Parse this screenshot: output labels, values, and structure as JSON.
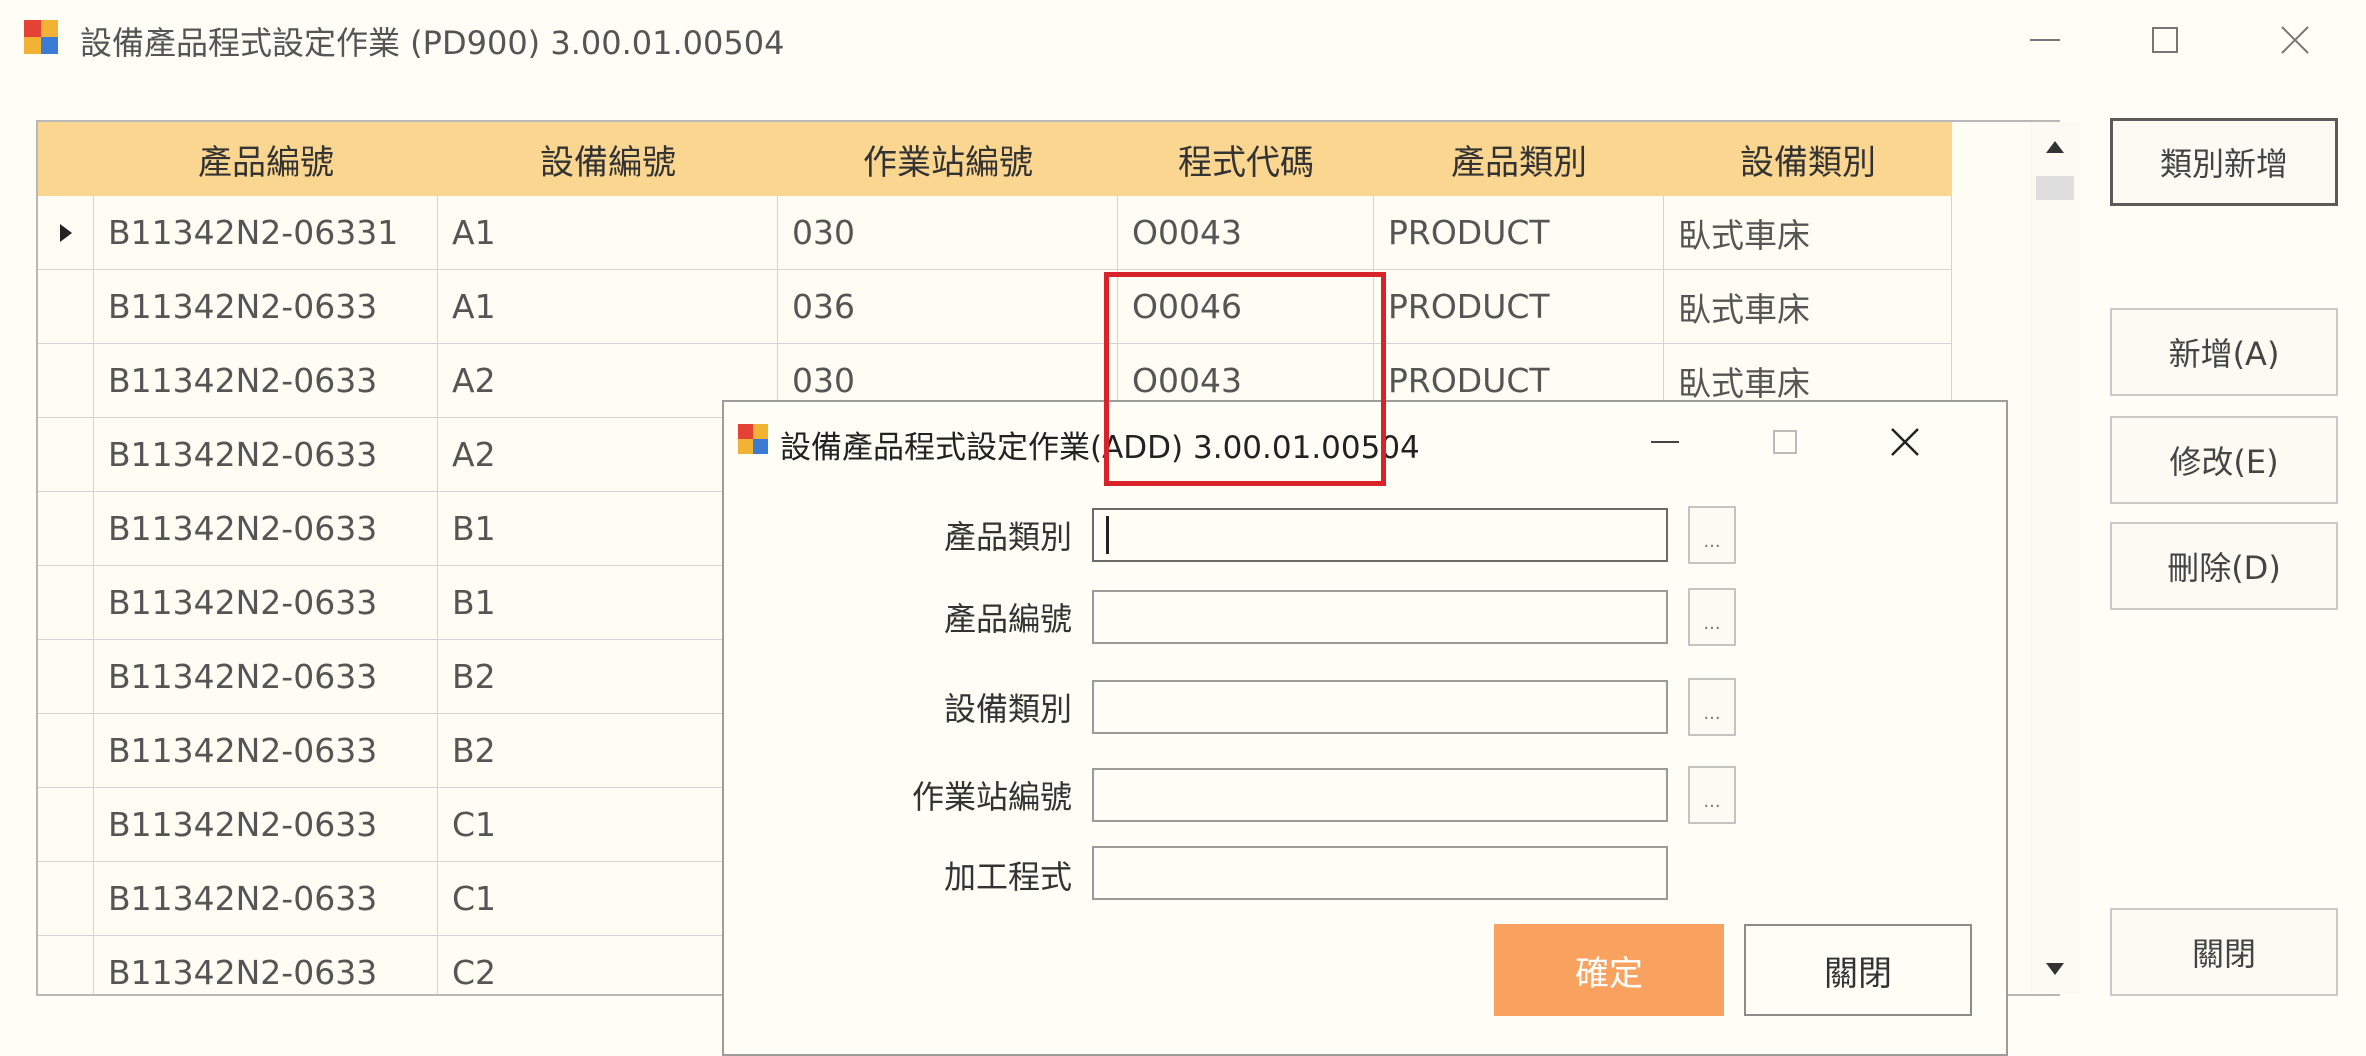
{
  "window": {
    "title": "設備產品程式設定作業 (PD900) 3.00.01.00504"
  },
  "grid": {
    "columns": [
      "產品編號",
      "設備編號",
      "作業站編號",
      "程式代碼",
      "產品類別",
      "設備類別"
    ],
    "rows": [
      [
        "B11342N2-06331",
        "A1",
        "030",
        "O0043",
        "PRODUCT",
        "臥式車床"
      ],
      [
        "B11342N2-0633",
        "A1",
        "036",
        "O0046",
        "PRODUCT",
        "臥式車床"
      ],
      [
        "B11342N2-0633",
        "A2",
        "030",
        "O0043",
        "PRODUCT",
        "臥式車床"
      ],
      [
        "B11342N2-0633",
        "A2",
        "",
        "",
        "",
        ""
      ],
      [
        "B11342N2-0633",
        "B1",
        "",
        "",
        "",
        ""
      ],
      [
        "B11342N2-0633",
        "B1",
        "",
        "",
        "",
        ""
      ],
      [
        "B11342N2-0633",
        "B2",
        "",
        "",
        "",
        ""
      ],
      [
        "B11342N2-0633",
        "B2",
        "",
        "",
        "",
        ""
      ],
      [
        "B11342N2-0633",
        "C1",
        "",
        "",
        "",
        ""
      ],
      [
        "B11342N2-0633",
        "C1",
        "",
        "",
        "",
        ""
      ],
      [
        "B11342N2-0633",
        "C2",
        "",
        "",
        "",
        ""
      ]
    ],
    "current_row": 0
  },
  "side_buttons": {
    "category_add": "類別新增",
    "add": "新增(A)",
    "edit": "修改(E)",
    "delete": "刪除(D)",
    "close": "關閉"
  },
  "dialog": {
    "title": "設備產品程式設定作業(ADD) 3.00.01.00504",
    "fields": [
      {
        "label": "產品類別",
        "value": "",
        "browse": "..."
      },
      {
        "label": "產品編號",
        "value": "",
        "browse": "..."
      },
      {
        "label": "設備類別",
        "value": "",
        "browse": "..."
      },
      {
        "label": "作業站編號",
        "value": "",
        "browse": "..."
      },
      {
        "label": "加工程式",
        "value": ""
      }
    ],
    "ok_label": "確定",
    "close_label": "關閉"
  },
  "colors": {
    "header_bg": "#fbd690",
    "ok_button": "#f9a25f",
    "highlight": "#d9232a"
  }
}
